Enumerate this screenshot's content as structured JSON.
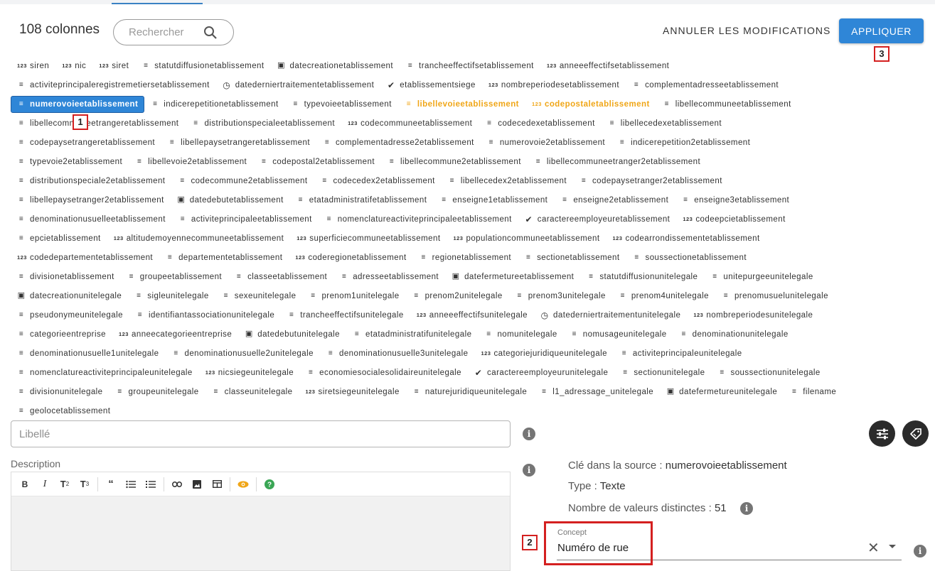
{
  "header": {
    "column_count": "108 colonnes",
    "search_placeholder": "Rechercher",
    "cancel_label": "ANNULER LES MODIFICATIONS",
    "apply_label": "APPLIQUER"
  },
  "columns": [
    [
      [
        "123",
        "siren",
        ""
      ],
      [
        "123",
        "nic",
        ""
      ],
      [
        "123",
        "siret",
        ""
      ],
      [
        "=",
        "statutdiffusionetablissement",
        ""
      ],
      [
        "cal",
        "datecreationetablissement",
        ""
      ],
      [
        "=",
        "trancheeffectifsetablissement",
        ""
      ],
      [
        "123",
        "anneeeffectifsetablissement",
        ""
      ]
    ],
    [
      [
        "=",
        "activiteprincipaleregistremetiersetablissement",
        ""
      ],
      [
        "clock",
        "datederniertraitementetablissement",
        ""
      ],
      [
        "check",
        "etablissementsiege",
        ""
      ],
      [
        "123",
        "nombreperiodesetablissement",
        ""
      ],
      [
        "=",
        "complementadresseetablissement",
        ""
      ]
    ],
    [
      [
        "=",
        "numerovoieetablissement",
        "selected"
      ],
      [
        "=",
        "indicerepetitionetablissement",
        ""
      ],
      [
        "=",
        "typevoieetablissement",
        ""
      ],
      [
        "=",
        "libellevoieetablissement",
        "orange"
      ],
      [
        "123",
        "codepostaletablissement",
        "orange"
      ],
      [
        "=",
        "libellecommuneetablissement",
        ""
      ]
    ],
    [
      [
        "=",
        "libellecommuneetrangeretablissement",
        ""
      ],
      [
        "=",
        "distributionspecialeetablissement",
        ""
      ],
      [
        "123",
        "codecommuneetablissement",
        ""
      ],
      [
        "=",
        "codecedexetablissement",
        ""
      ],
      [
        "=",
        "libellecedexetablissement",
        ""
      ]
    ],
    [
      [
        "=",
        "codepaysetrangeretablissement",
        ""
      ],
      [
        "=",
        "libellepaysetrangeretablissement",
        ""
      ],
      [
        "=",
        "complementadresse2etablissement",
        ""
      ],
      [
        "=",
        "numerovoie2etablissement",
        ""
      ],
      [
        "=",
        "indicerepetition2etablissement",
        ""
      ]
    ],
    [
      [
        "=",
        "typevoie2etablissement",
        ""
      ],
      [
        "=",
        "libellevoie2etablissement",
        ""
      ],
      [
        "=",
        "codepostal2etablissement",
        ""
      ],
      [
        "=",
        "libellecommune2etablissement",
        ""
      ],
      [
        "=",
        "libellecommuneetranger2etablissement",
        ""
      ]
    ],
    [
      [
        "=",
        "distributionspeciale2etablissement",
        ""
      ],
      [
        "=",
        "codecommune2etablissement",
        ""
      ],
      [
        "=",
        "codecedex2etablissement",
        ""
      ],
      [
        "=",
        "libellecedex2etablissement",
        ""
      ],
      [
        "=",
        "codepaysetranger2etablissement",
        ""
      ]
    ],
    [
      [
        "=",
        "libellepaysetranger2etablissement",
        ""
      ],
      [
        "cal",
        "datedebutetablissement",
        ""
      ],
      [
        "=",
        "etatadministratifetablissement",
        ""
      ],
      [
        "=",
        "enseigne1etablissement",
        ""
      ],
      [
        "=",
        "enseigne2etablissement",
        ""
      ],
      [
        "=",
        "enseigne3etablissement",
        ""
      ]
    ],
    [
      [
        "=",
        "denominationusuelleetablissement",
        ""
      ],
      [
        "=",
        "activiteprincipaleetablissement",
        ""
      ],
      [
        "=",
        "nomenclatureactiviteprincipaleetablissement",
        ""
      ],
      [
        "check",
        "caractereemployeuretablissement",
        ""
      ],
      [
        "123",
        "codeepcietablissement",
        ""
      ]
    ],
    [
      [
        "=",
        "epcietablissement",
        ""
      ],
      [
        "123",
        "altitudemoyennecommuneetablissement",
        ""
      ],
      [
        "123",
        "superficiecommuneetablissement",
        ""
      ],
      [
        "123",
        "populationcommuneetablissement",
        ""
      ],
      [
        "123",
        "codearrondissementetablissement",
        ""
      ]
    ],
    [
      [
        "123",
        "codedepartementetablissement",
        ""
      ],
      [
        "=",
        "departementetablissement",
        ""
      ],
      [
        "123",
        "coderegionetablissement",
        ""
      ],
      [
        "=",
        "regionetablissement",
        ""
      ],
      [
        "=",
        "sectionetablissement",
        ""
      ],
      [
        "=",
        "soussectionetablissement",
        ""
      ]
    ],
    [
      [
        "=",
        "divisionetablissement",
        ""
      ],
      [
        "=",
        "groupeetablissement",
        ""
      ],
      [
        "=",
        "classeetablissement",
        ""
      ],
      [
        "=",
        "adresseetablissement",
        ""
      ],
      [
        "cal",
        "datefermetureetablissement",
        ""
      ],
      [
        "=",
        "statutdiffusionunitelegale",
        ""
      ],
      [
        "=",
        "unitepurgeeunitelegale",
        ""
      ]
    ],
    [
      [
        "cal",
        "datecreationunitelegale",
        ""
      ],
      [
        "=",
        "sigleunitelegale",
        ""
      ],
      [
        "=",
        "sexeunitelegale",
        ""
      ],
      [
        "=",
        "prenom1unitelegale",
        ""
      ],
      [
        "=",
        "prenom2unitelegale",
        ""
      ],
      [
        "=",
        "prenom3unitelegale",
        ""
      ],
      [
        "=",
        "prenom4unitelegale",
        ""
      ],
      [
        "=",
        "prenomusuelunitelegale",
        ""
      ]
    ],
    [
      [
        "=",
        "pseudonymeunitelegale",
        ""
      ],
      [
        "=",
        "identifiantassociationunitelegale",
        ""
      ],
      [
        "=",
        "trancheeffectifsunitelegale",
        ""
      ],
      [
        "123",
        "anneeeffectifsunitelegale",
        ""
      ],
      [
        "clock",
        "datederniertraitementunitelegale",
        ""
      ],
      [
        "123",
        "nombreperiodesunitelegale",
        ""
      ]
    ],
    [
      [
        "=",
        "categorieentreprise",
        ""
      ],
      [
        "123",
        "anneecategorieentreprise",
        ""
      ],
      [
        "cal",
        "datedebutunitelegale",
        ""
      ],
      [
        "=",
        "etatadministratifunitelegale",
        ""
      ],
      [
        "=",
        "nomunitelegale",
        ""
      ],
      [
        "=",
        "nomusageunitelegale",
        ""
      ],
      [
        "=",
        "denominationunitelegale",
        ""
      ]
    ],
    [
      [
        "=",
        "denominationusuelle1unitelegale",
        ""
      ],
      [
        "=",
        "denominationusuelle2unitelegale",
        ""
      ],
      [
        "=",
        "denominationusuelle3unitelegale",
        ""
      ],
      [
        "123",
        "categoriejuridiqueunitelegale",
        ""
      ],
      [
        "=",
        "activiteprincipaleunitelegale",
        ""
      ]
    ],
    [
      [
        "=",
        "nomenclatureactiviteprincipaleunitelegale",
        ""
      ],
      [
        "123",
        "nicsiegeunitelegale",
        ""
      ],
      [
        "=",
        "economiesocialesolidaireunitelegale",
        ""
      ],
      [
        "check",
        "caractereemployeurunitelegale",
        ""
      ],
      [
        "=",
        "sectionunitelegale",
        ""
      ],
      [
        "=",
        "soussectionunitelegale",
        ""
      ]
    ],
    [
      [
        "=",
        "divisionunitelegale",
        ""
      ],
      [
        "=",
        "groupeunitelegale",
        ""
      ],
      [
        "=",
        "classeunitelegale",
        ""
      ],
      [
        "123",
        "siretsiegeunitelegale",
        ""
      ],
      [
        "=",
        "naturejuridiqueunitelegale",
        ""
      ],
      [
        "=",
        "l1_adressage_unitelegale",
        ""
      ],
      [
        "cal",
        "datefermetureunitelegale",
        ""
      ],
      [
        "=",
        "filename",
        ""
      ]
    ],
    [
      [
        "=",
        "geolocetablissement",
        ""
      ]
    ]
  ],
  "annotations": {
    "a1": "1",
    "a2": "2",
    "a3": "3"
  },
  "form": {
    "libelle_placeholder": "Libellé",
    "description_label": "Description"
  },
  "details": {
    "key_label": "Clé dans la source :",
    "key_value": "numerovoieetablissement",
    "type_label": "Type :",
    "type_value": "Texte",
    "distinct_label": "Nombre de valeurs distinctes :",
    "distinct_value": "51",
    "concept_label": "Concept",
    "concept_value": "Numéro de rue"
  },
  "colors": {
    "accent": "#2f86d7",
    "highlight": "#f0a617",
    "annotation": "#d42020"
  }
}
